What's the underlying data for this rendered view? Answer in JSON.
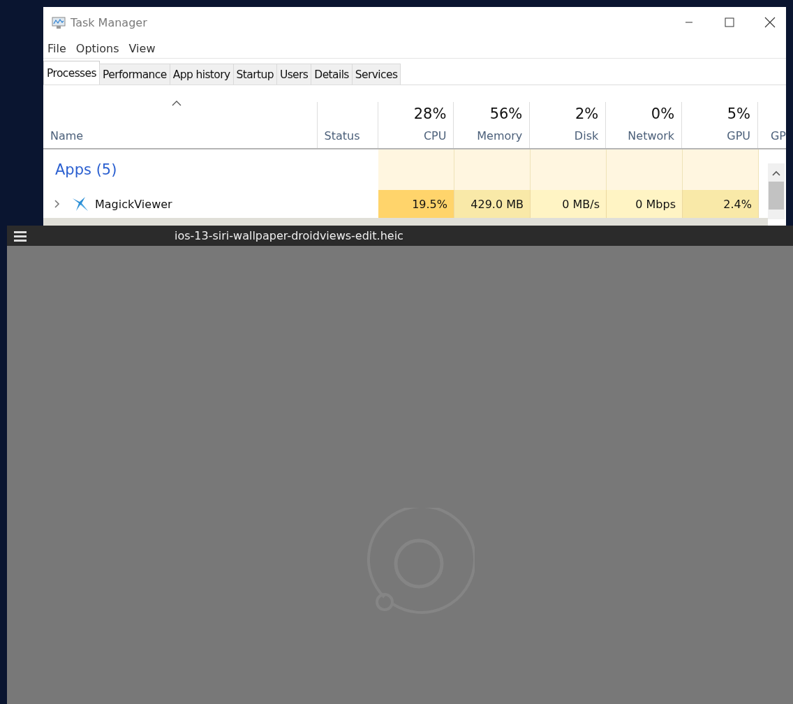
{
  "task_manager": {
    "title": "Task Manager",
    "menu": [
      "File",
      "Options",
      "View"
    ],
    "tabs": [
      {
        "label": "Processes",
        "selected": true
      },
      {
        "label": "Performance",
        "selected": false
      },
      {
        "label": "App history",
        "selected": false
      },
      {
        "label": "Startup",
        "selected": false
      },
      {
        "label": "Users",
        "selected": false
      },
      {
        "label": "Details",
        "selected": false
      },
      {
        "label": "Services",
        "selected": false
      }
    ],
    "columns": [
      {
        "label": "Name",
        "sorted": true
      },
      {
        "label": "Status",
        "sorted": false
      },
      {
        "percent": "28%",
        "label": "CPU",
        "sorted": false
      },
      {
        "percent": "56%",
        "label": "Memory",
        "sorted": false
      },
      {
        "percent": "2%",
        "label": "Disk",
        "sorted": false
      },
      {
        "percent": "0%",
        "label": "Network",
        "sorted": false
      },
      {
        "percent": "5%",
        "label": "GPU",
        "sorted": false
      },
      {
        "label": "GP",
        "sorted": false
      }
    ],
    "group": {
      "label": "Apps (5)"
    },
    "rows": [
      {
        "expanded": false,
        "cells": [
          {
            "text": "MagickViewer",
            "kind": "name"
          },
          {
            "text": "",
            "kind": "status"
          },
          {
            "text": "19.5%",
            "color": "#ffd46b"
          },
          {
            "text": "429.0 MB",
            "color": "#f9e9a8"
          },
          {
            "text": "0 MB/s",
            "color": "#fff4c4"
          },
          {
            "text": "0 Mbps",
            "color": "#fff4c4"
          },
          {
            "text": "2.4%",
            "color": "#f9e9a8"
          }
        ]
      }
    ]
  },
  "viewer": {
    "title": "ios-13-siri-wallpaper-droidviews-edit.heic"
  }
}
